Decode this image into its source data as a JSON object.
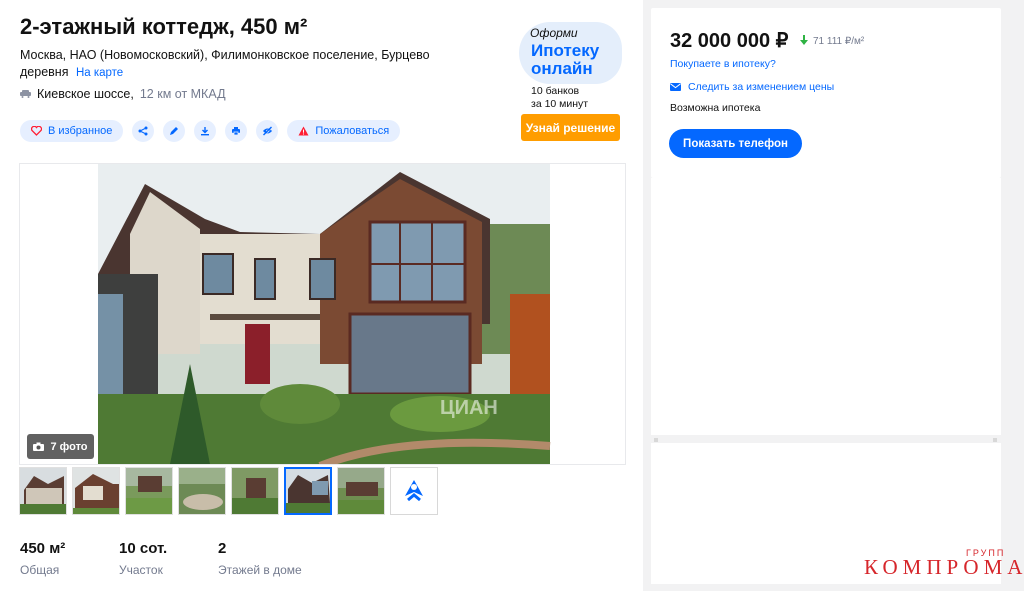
{
  "listing": {
    "title": "2-этажный коттедж, 450 м²",
    "address": "Москва, НАО (Новомосковский), Филимонковское поселение, Бурцево деревня",
    "map_link": "На карте",
    "highway": "Киевское шоссе,",
    "distance": "12 км от МКАД"
  },
  "actions": {
    "favorite": "В избранное",
    "complain": "Пожаловаться",
    "icons": [
      "share-icon",
      "edit-icon",
      "download-icon",
      "print-icon",
      "hide-icon"
    ]
  },
  "promo": {
    "small": "Оформи",
    "big_line1": "Ипотеку",
    "big_line2": "онлайн",
    "banks_line1": "10 банков",
    "banks_line2": "за 10 минут",
    "button": "Узнай решение"
  },
  "gallery": {
    "photo_count": "7 фото",
    "watermark": "ЦИАН",
    "active_thumb": 4
  },
  "stats": [
    {
      "value": "450 м²",
      "label": "Общая"
    },
    {
      "value": "10 сот.",
      "label": "Участок"
    },
    {
      "value": "2",
      "label": "Этажей в доме"
    }
  ],
  "sidebar": {
    "price": "32 000 000 ₽",
    "price_per_m2": "71 111 ₽/м²",
    "mortgage_question": "Покупаете в ипотеку?",
    "follow_price": "Следить за изменением цены",
    "mortgage_possible": "Возможна ипотека",
    "show_phone": "Показать телефон"
  },
  "watermark": {
    "brand": "КОМПРОМАТ",
    "sub": "ГРУПП"
  },
  "colors": {
    "accent": "#0468ff",
    "promo_button": "#ff9d00",
    "price_down": "#2fb344",
    "complain_icon": "#ff1f34"
  }
}
